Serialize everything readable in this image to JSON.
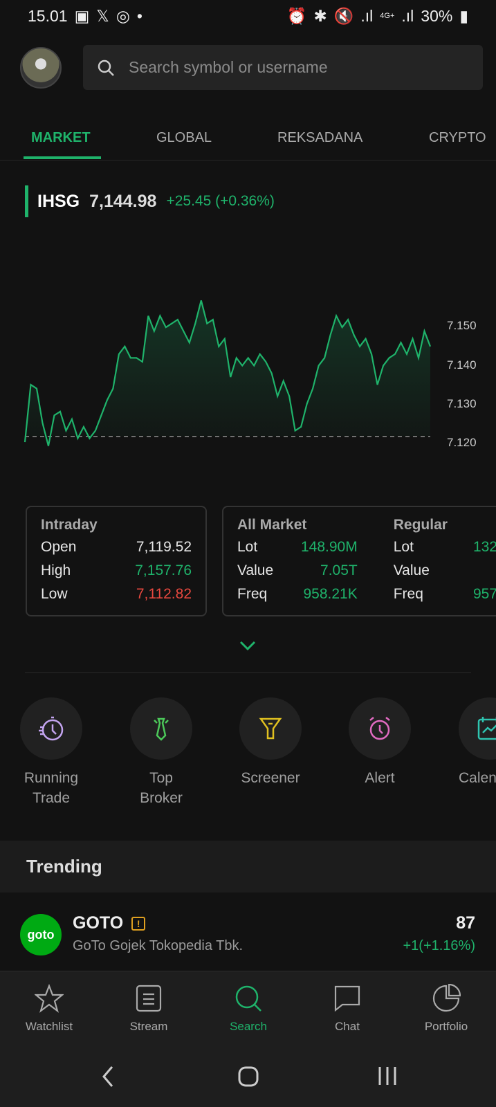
{
  "status_bar": {
    "time": "15.01",
    "battery": "30%",
    "network": "4G+"
  },
  "search": {
    "placeholder": "Search symbol or username"
  },
  "tabs": [
    "MARKET",
    "GLOBAL",
    "REKSADANA",
    "CRYPTO"
  ],
  "index": {
    "name": "IHSG",
    "value": "7,144.98",
    "change": "+25.45 (+0.36%)"
  },
  "chart_data": {
    "type": "line",
    "y_ticks": [
      "7.150",
      "7.140",
      "7.130",
      "7.120"
    ],
    "ylim": [
      7.115,
      7.156
    ],
    "baseline": 7.1195,
    "color": "#1fb36b",
    "values": [
      7.118,
      7.133,
      7.132,
      7.123,
      7.117,
      7.125,
      7.126,
      7.121,
      7.124,
      7.119,
      7.122,
      7.119,
      7.121,
      7.125,
      7.129,
      7.132,
      7.141,
      7.143,
      7.14,
      7.14,
      7.139,
      7.151,
      7.147,
      7.151,
      7.148,
      7.149,
      7.15,
      7.147,
      7.144,
      7.149,
      7.155,
      7.149,
      7.15,
      7.143,
      7.145,
      7.135,
      7.14,
      7.138,
      7.14,
      7.138,
      7.141,
      7.139,
      7.136,
      7.13,
      7.134,
      7.13,
      7.121,
      7.122,
      7.128,
      7.132,
      7.138,
      7.14,
      7.146,
      7.151,
      7.148,
      7.15,
      7.146,
      7.143,
      7.145,
      7.141,
      7.133,
      7.138,
      7.14,
      7.141,
      7.144,
      7.141,
      7.145,
      7.14,
      7.147,
      7.143
    ]
  },
  "intraday": {
    "title": "Intraday",
    "rows": [
      {
        "label": "Open",
        "value": "7,119.52"
      },
      {
        "label": "High",
        "value": "7,157.76"
      },
      {
        "label": "Low",
        "value": "7,112.82"
      }
    ]
  },
  "all_market": {
    "title": "All Market",
    "rows": [
      {
        "label": "Lot",
        "value": "148.90M"
      },
      {
        "label": "Value",
        "value": "7.05T"
      },
      {
        "label": "Freq",
        "value": "958.21K"
      }
    ]
  },
  "regular": {
    "title": "Regular",
    "rows": [
      {
        "label": "Lot",
        "value": "132"
      },
      {
        "label": "Value",
        "value": ""
      },
      {
        "label": "Freq",
        "value": "957"
      }
    ]
  },
  "menu": [
    {
      "label": "Running Trade",
      "icon": "stopwatch-icon",
      "color": "#c3a4f0"
    },
    {
      "label": "Top Broker",
      "icon": "tie-icon",
      "color": "#4cc95a"
    },
    {
      "label": "Screener",
      "icon": "filter-icon",
      "color": "#e0c020"
    },
    {
      "label": "Alert",
      "icon": "alarm-icon",
      "color": "#e06ac0"
    },
    {
      "label": "Calen",
      "icon": "calendar-chart-icon",
      "color": "#2ec4b0"
    }
  ],
  "trending": {
    "title": "Trending",
    "items": [
      {
        "symbol": "GOTO",
        "logo": "goto",
        "name": "GoTo Gojek Tokopedia Tbk.",
        "price": "87",
        "change": "+1(+1.16%)"
      }
    ]
  },
  "bottom_nav": [
    {
      "label": "Watchlist"
    },
    {
      "label": "Stream"
    },
    {
      "label": "Search",
      "active": true
    },
    {
      "label": "Chat"
    },
    {
      "label": "Portfolio"
    }
  ]
}
